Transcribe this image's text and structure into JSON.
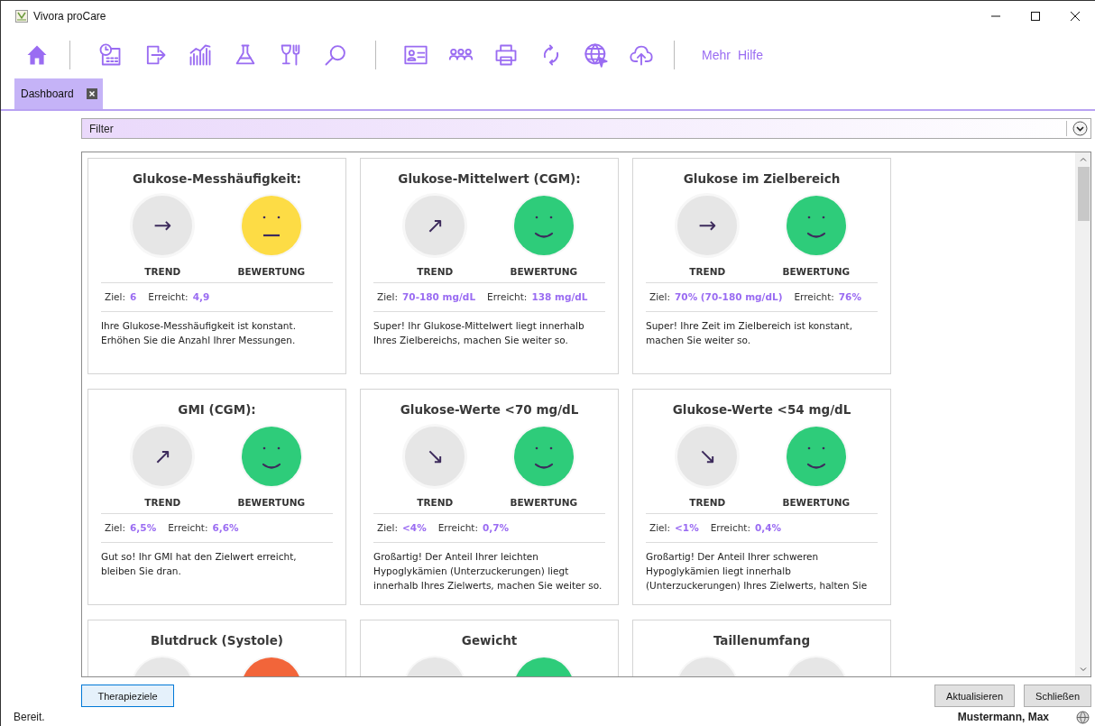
{
  "window": {
    "title": "Vivora proCare"
  },
  "toolbar": {
    "links": [
      "Mehr",
      "Hilfe"
    ]
  },
  "tabs": [
    {
      "label": "Dashboard",
      "selected": true
    }
  ],
  "filter": {
    "label": "Filter"
  },
  "cards": [
    {
      "title": "Glukose-Messhäufigkeit:",
      "trend": "→",
      "rating": {
        "kind": "neutral"
      },
      "trend_label": "TREND",
      "rating_label": "BEWERTUNG",
      "target_label": "Ziel:",
      "target": "6",
      "achieved_label": "Erreicht:",
      "achieved": "4,9",
      "text": "Ihre Glukose-Messhäufigkeit ist konstant. Erhöhen Sie die Anzahl Ihrer Messungen."
    },
    {
      "title": "Glukose-Mittelwert (CGM):",
      "trend": "↗",
      "rating": {
        "kind": "good"
      },
      "trend_label": "TREND",
      "rating_label": "BEWERTUNG",
      "target_label": "Ziel:",
      "target": "70-180 mg/dL",
      "achieved_label": "Erreicht:",
      "achieved": "138 mg/dL",
      "text": "Super! Ihr Glukose-Mittelwert liegt innerhalb Ihres Zielbereichs, machen Sie weiter so."
    },
    {
      "title": "Glukose im Zielbereich",
      "trend": "→",
      "rating": {
        "kind": "good"
      },
      "trend_label": "TREND",
      "rating_label": "BEWERTUNG",
      "target_label": "Ziel:",
      "target": "70% (70-180 mg/dL)",
      "achieved_label": "Erreicht:",
      "achieved": "76%",
      "text": "Super! Ihre Zeit im Zielbereich ist konstant, machen Sie weiter so."
    },
    {
      "title": "GMI (CGM):",
      "trend": "↗",
      "rating": {
        "kind": "good"
      },
      "trend_label": "TREND",
      "rating_label": "BEWERTUNG",
      "target_label": "Ziel:",
      "target": "6,5%",
      "achieved_label": "Erreicht:",
      "achieved": "6,6%",
      "text": "Gut so! Ihr GMI hat den Zielwert erreicht, bleiben Sie dran."
    },
    {
      "title": "Glukose-Werte <70 mg/dL",
      "trend": "↘",
      "rating": {
        "kind": "good"
      },
      "trend_label": "TREND",
      "rating_label": "BEWERTUNG",
      "target_label": "Ziel:",
      "target": "<4%",
      "achieved_label": "Erreicht:",
      "achieved": "0,7%",
      "text": "Großartig! Der Anteil Ihrer leichten Hypoglykämien (Unterzuckerungen) liegt innerhalb Ihres Zielwerts, machen Sie weiter so."
    },
    {
      "title": "Glukose-Werte <54 mg/dL",
      "trend": "↘",
      "rating": {
        "kind": "good"
      },
      "trend_label": "TREND",
      "rating_label": "BEWERTUNG",
      "target_label": "Ziel:",
      "target": "<1%",
      "achieved_label": "Erreicht:",
      "achieved": "0,4%",
      "text": "Großartig! Der Anteil Ihrer schweren Hypoglykämien liegt innerhalb (Unterzuckerungen) Ihres Zielwerts, halten Sie"
    },
    {
      "title": "Blutdruck (Systole)",
      "rating": {
        "kind": "bad"
      }
    },
    {
      "title": "Gewicht",
      "rating": {
        "kind": "good"
      }
    },
    {
      "title": "Taillenumfang",
      "rating": {
        "kind": "none"
      }
    }
  ],
  "buttons": {
    "left": [
      "Therapieziele"
    ],
    "right": [
      "Aktualisieren",
      "Schließen"
    ]
  },
  "status_bar": {
    "text": "Bereit.",
    "user": "Mustermann, Max"
  }
}
